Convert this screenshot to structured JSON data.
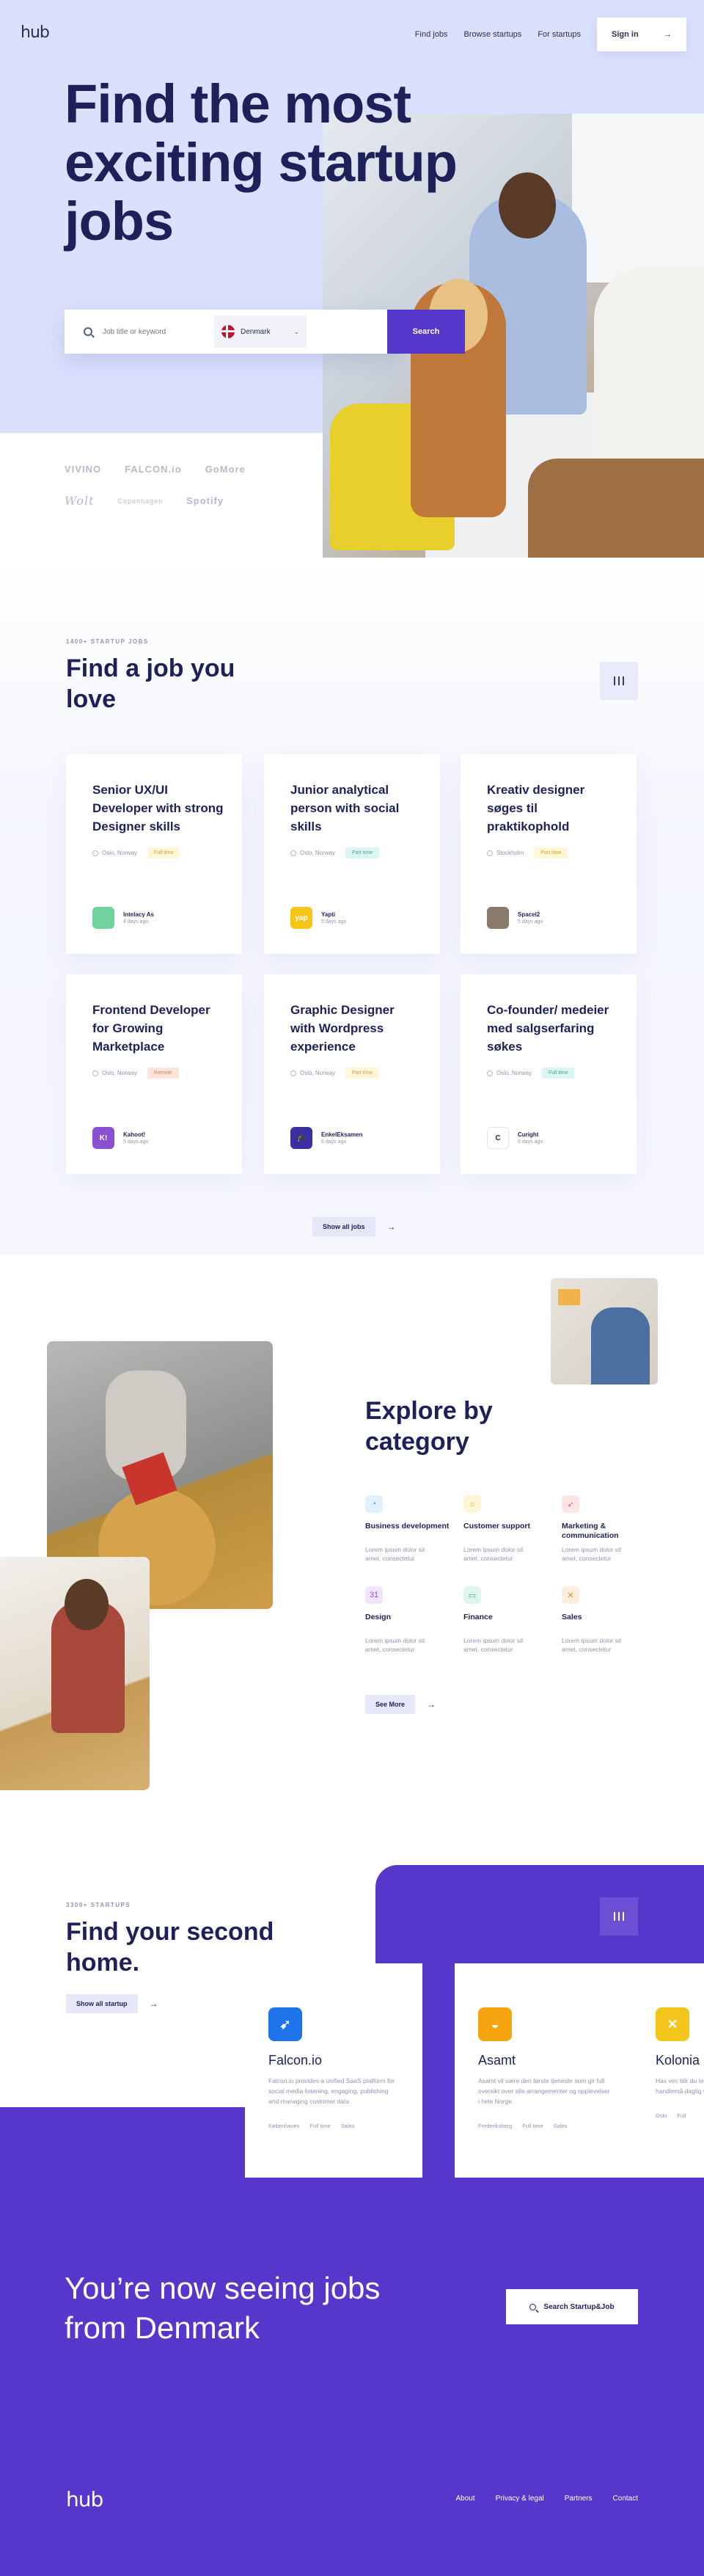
{
  "nav": {
    "logo": "hub",
    "links": [
      "Find jobs",
      "Browse startups",
      "For startups"
    ],
    "signin": "Sign in",
    "signin_arrow": "→"
  },
  "hero": {
    "title": "Find the most exciting startup jobs",
    "search": {
      "placeholder": "Job title or keyword",
      "country": "Denmark",
      "button": "Search"
    }
  },
  "brands": [
    "VIVINO",
    "FALCON.io",
    "GoMore",
    "Wolt",
    "Copenhagen",
    "Spotify"
  ],
  "jobs": {
    "eyebrow": "1400+ STARTUP JOBS",
    "title": "Find a job you love",
    "show_all": "Show all jobs",
    "cards": [
      {
        "title": "Senior UX/UI Developer with strong Designer skills",
        "location": "Oslo, Norway",
        "tag": "Full time",
        "tag_color": "yellow",
        "company": "Intelacy As",
        "time": "4 days ago",
        "logo_color": "#6fd39b",
        "logo_text": ""
      },
      {
        "title": "Junior analytical person with social skills",
        "location": "Oslo, Norway",
        "tag": "Part time",
        "tag_color": "teal",
        "company": "Yapti",
        "time": "5 days ago",
        "logo_color": "#f5c518",
        "logo_text": "yap"
      },
      {
        "title": "Kreativ designer søges til praktikophold",
        "location": "Stockholm",
        "tag": "Part time",
        "tag_color": "yellow",
        "company": "Spacel2",
        "time": "5 days ago",
        "logo_color": "#8a7a6a",
        "logo_text": ""
      },
      {
        "title": "Frontend Developer for Growing Marketplace",
        "location": "Oslo, Norway",
        "tag": "Remote",
        "tag_color": "orange",
        "company": "Kahoot!",
        "time": "5 days ago",
        "logo_color": "#8b4fd2",
        "logo_text": "K!"
      },
      {
        "title": "Graphic Designer with Wordpress experience",
        "location": "Oslo, Norway",
        "tag": "Part time",
        "tag_color": "yellow",
        "company": "EnkelEksamen",
        "time": "6 days ago",
        "logo_color": "#3b2fa0",
        "logo_text": "🎓"
      },
      {
        "title": "Co-founder/ medeier med salgserfaring søkes",
        "location": "Oslo, Norway",
        "tag": "Full time",
        "tag_color": "teal",
        "company": "Curight",
        "time": "6 days ago",
        "logo_color": "#ffffff",
        "logo_text": "C"
      }
    ]
  },
  "category": {
    "title": "Explore by category",
    "see_more": "See More",
    "items": [
      {
        "name": "Business development",
        "desc": "Lorem ipsum dolor sit amet, consectetur",
        "icon": "chart-icon",
        "glyph": "◔",
        "bg": "#e1f0fd",
        "fg": "#3d8be0"
      },
      {
        "name": "Customer support",
        "desc": "Lorem ipsum dolor sit amet, consectetur",
        "icon": "sun-icon",
        "glyph": "☼",
        "bg": "#fff6d6",
        "fg": "#d8a62a"
      },
      {
        "name": "Marketing & communication",
        "desc": "Lorem ipsum dolor sit amet, consectetur",
        "icon": "rocket-icon",
        "glyph": "➶",
        "bg": "#ffe4e6",
        "fg": "#e0506a"
      },
      {
        "name": "Design",
        "desc": "Lorem ipsum dolor sit amet, consectetur",
        "icon": "calendar-icon",
        "glyph": "31",
        "bg": "#f1e5fd",
        "fg": "#9a4fd8"
      },
      {
        "name": "Finance",
        "desc": "Lorem ipsum dolor sit amet, consectetur",
        "icon": "wallet-icon",
        "glyph": "▭",
        "bg": "#def6ee",
        "fg": "#3aa883"
      },
      {
        "name": "Sales",
        "desc": "Lorem ipsum dolor sit amet, consectetur",
        "icon": "tools-icon",
        "glyph": "✕",
        "bg": "#ffeedd",
        "fg": "#e0873a"
      }
    ]
  },
  "startups": {
    "eyebrow": "3300+ STARTUPS",
    "title": "Find your second home.",
    "show_all": "Show all startup",
    "cards": [
      {
        "name": "Falcon.io",
        "desc": "Falcon.io provides a unified SaaS platform for social media listening, engaging, publishing and managing customer data",
        "meta": [
          "Københaven",
          "Full time",
          "Sales"
        ],
        "logo_color": "#1e74e8",
        "logo_text": "➹"
      },
      {
        "name": "Asamt",
        "desc": "Asamt vil være den første tjeneste som gir full oversikt over alle arrangementer og opplevelser i hele Norge.",
        "meta": [
          "Frederiksberg",
          "Full time",
          "Sales"
        ],
        "logo_color": "#f5a40f",
        "logo_text": "◒"
      },
      {
        "name": "Kolonia",
        "desc": "Has vec blir du teknologibaserte beste handlemå daglig varer",
        "meta": [
          "Oslo",
          "Full"
        ],
        "logo_color": "#f4c61c",
        "logo_text": "✕"
      }
    ]
  },
  "cta": {
    "title": "You’re now seeing jobs from Denmark",
    "button": "Search Startup&Job"
  },
  "footer": {
    "logo": "hub",
    "links": [
      "About",
      "Privacy & legal",
      "Partners",
      "Contact"
    ]
  }
}
